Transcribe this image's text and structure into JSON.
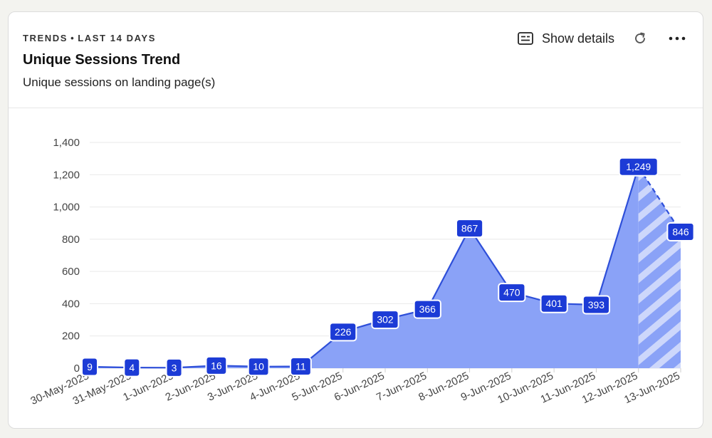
{
  "header": {
    "eyebrow_left": "TRENDS",
    "eyebrow_sep": "•",
    "eyebrow_right": "LAST 14 DAYS",
    "title": "Unique Sessions Trend",
    "subtitle": "Unique sessions on landing page(s)"
  },
  "actions": {
    "show_details_label": "Show details",
    "show_details_icon": "details-card-icon",
    "refresh_icon": "refresh-icon",
    "more_icon": "more-horizontal-icon"
  },
  "colors": {
    "line": "#2e4fd9",
    "fill": "#8aa2f7",
    "label_bg": "#1c3bd6",
    "label_border": "#ffffff",
    "grid": "#e9e9e9"
  },
  "chart_data": {
    "type": "area",
    "title": "",
    "xlabel": "",
    "ylabel": "",
    "categories": [
      "30-May-2025",
      "31-May-2025",
      "1-Jun-2025",
      "2-Jun-2025",
      "3-Jun-2025",
      "4-Jun-2025",
      "5-Jun-2025",
      "6-Jun-2025",
      "7-Jun-2025",
      "8-Jun-2025",
      "9-Jun-2025",
      "10-Jun-2025",
      "11-Jun-2025",
      "12-Jun-2025",
      "13-Jun-2025"
    ],
    "series": [
      {
        "values": [
          9,
          4,
          3,
          16,
          10,
          11,
          226,
          302,
          366,
          867,
          470,
          401,
          393,
          1249,
          846
        ]
      }
    ],
    "data_labels": [
      "9",
      "4",
      "3",
      "16",
      "10",
      "11",
      "226",
      "302",
      "366",
      "867",
      "470",
      "401",
      "393",
      "1,249",
      "846"
    ],
    "projected_from_index": 13,
    "ylim": [
      0,
      1400
    ],
    "yticks": [
      0,
      200,
      400,
      600,
      800,
      1000,
      1200,
      1400
    ],
    "ytick_labels": [
      "0",
      "200",
      "400",
      "600",
      "800",
      "1,000",
      "1,200",
      "1,400"
    ],
    "grid": true,
    "legend": "none"
  }
}
